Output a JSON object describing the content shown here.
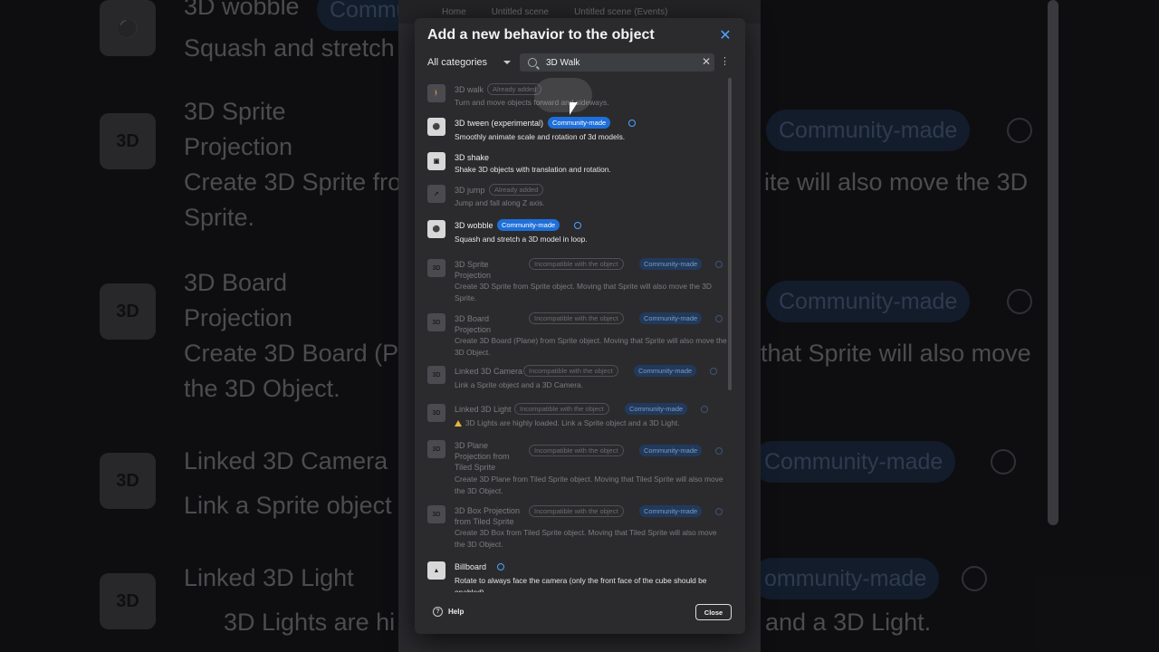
{
  "editor": {
    "tabs": [
      "Home",
      "Untitled scene",
      "Untitled scene (Events)"
    ]
  },
  "background": {
    "rows": [
      {
        "title": "3D wobble",
        "line2": "Squash and stretch",
        "pill": "Community-made"
      },
      {
        "title": "3D Sprite",
        "line2": "Projection",
        "line3": "Create 3D Sprite fro",
        "line4": "Sprite.",
        "right_pill": "Community-made",
        "right_text": "ite will also move the 3D"
      },
      {
        "title": "3D Board",
        "line2": "Projection",
        "line3": "Create 3D Board (Pl",
        "line4": "the 3D Object.",
        "right_pill": "Community-made",
        "right_text": "that Sprite will also move"
      },
      {
        "title": "Linked 3D Camera",
        "line2": "Link a Sprite object",
        "right_pill": "Community-made"
      },
      {
        "title": "Linked 3D Light",
        "line2": "3D Lights are hi",
        "right_pill": "ommunity-made",
        "right_text": "and a 3D Light."
      }
    ]
  },
  "dialog": {
    "title": "Add a new behavior to the object",
    "category": "All categories",
    "search_value": "3D Walk",
    "help_label": "Help",
    "close_label": "Close",
    "tags": {
      "already_added": "Already added",
      "community": "Community-made",
      "incompatible": "Incompatible with the object"
    },
    "items": [
      {
        "name": "3D walk",
        "desc": "Turn and move objects forward and sideways.",
        "state": "added",
        "icon": "walker-icon"
      },
      {
        "name": "3D tween (experimental)",
        "desc": "Smoothly animate scale and rotation of 3d models.",
        "state": "community",
        "icon": "tween-icon"
      },
      {
        "name": "3D shake",
        "desc": "Shake 3D objects with translation and rotation.",
        "state": "normal",
        "icon": "shake-icon"
      },
      {
        "name": "3D jump",
        "desc": "Jump and fall along Z axis.",
        "state": "added",
        "icon": "jump-icon"
      },
      {
        "name": "3D wobble",
        "desc": "Squash and stretch a 3D model in loop.",
        "state": "community",
        "icon": "wobble-icon"
      },
      {
        "name": "3D Sprite Projection",
        "desc": "Create 3D Sprite from Sprite object. Moving that Sprite will also move the 3D Sprite.",
        "state": "incompatible",
        "icon": "3d-projection-icon"
      },
      {
        "name": "3D Board Projection",
        "desc": "Create 3D Board (Plane) from Sprite object. Moving that Sprite will also move the 3D Object.",
        "state": "incompatible",
        "icon": "3d-projection-icon"
      },
      {
        "name": "Linked 3D Camera",
        "desc": "Link a Sprite object and a 3D Camera.",
        "state": "incompatible",
        "icon": "3d-camera-icon"
      },
      {
        "name": "Linked 3D Light",
        "desc": "3D Lights are highly loaded. Link a Sprite object and a 3D Light.",
        "state": "incompatible",
        "icon": "3d-light-icon"
      },
      {
        "name": "3D Plane Projection from Tiled Sprite",
        "desc": "Create 3D Plane from Tiled Sprite object. Moving that Tiled Sprite will also move the 3D Object.",
        "state": "incompatible",
        "icon": "3d-projection-icon"
      },
      {
        "name": "3D Box Projection from Tiled Sprite",
        "desc": "Create 3D Box from Tiled Sprite object. Moving that Tiled Sprite will also move the 3D Object.",
        "state": "incompatible",
        "icon": "3d-projection-icon"
      },
      {
        "name": "Billboard",
        "desc": "Rotate to always face the camera (only the front face of the cube should be enabled).",
        "state": "info",
        "icon": "tree-icon"
      }
    ]
  },
  "colors": {
    "accent": "#4da3ff",
    "community_tag": "#1e6fd9",
    "dialog_bg": "#2b2b2e"
  }
}
